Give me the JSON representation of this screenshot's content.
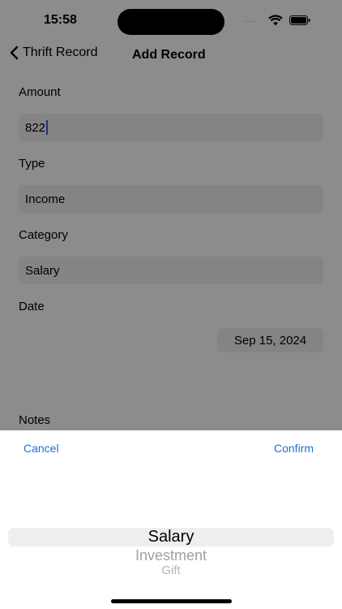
{
  "status_bar": {
    "time": "15:58",
    "signal": "....",
    "wifi_icon": "wifi-icon",
    "battery_icon": "battery-icon"
  },
  "nav": {
    "back_label": "Thrift Record",
    "title": "Add Record",
    "back_icon": "chevron-left-icon"
  },
  "form": {
    "amount_label": "Amount",
    "amount_value": "822",
    "type_label": "Type",
    "type_value": "Income",
    "category_label": "Category",
    "category_value": "Salary",
    "date_label": "Date",
    "date_value": "Sep 15, 2024",
    "notes_label": "Notes"
  },
  "picker_sheet": {
    "cancel_label": "Cancel",
    "confirm_label": "Confirm",
    "options": [
      "Salary",
      "Investment",
      "Gift"
    ],
    "selected": "Salary"
  },
  "colors": {
    "accent": "#1f6fd6",
    "field_bg": "#e4e4e9",
    "overlay": "rgba(0,0,0,0.42)"
  }
}
